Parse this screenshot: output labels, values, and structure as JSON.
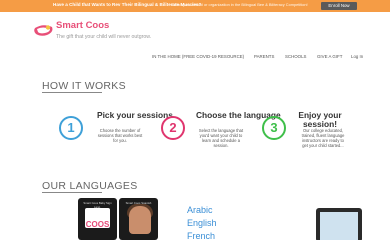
{
  "promo": {
    "title": "Have a Child that Wants to Rev Their Bilingual & Biliterate Muscles?",
    "description": "Enroll your school or organization in the Bilingual Bee & Biliteracy Competition!",
    "button_label": "Enroll Now"
  },
  "header": {
    "logo_text": "SMART COOS",
    "brand": "Smart Coos",
    "tagline": "The gift that your child will never outgrow."
  },
  "nav": {
    "home": "IN THE HOME (FREE COVID-19 RESOURCE)",
    "parents": "PARENTS",
    "schools": "SCHOOLS",
    "gift": "GIVE A GIFT",
    "login": "Log In"
  },
  "how_it_works": {
    "title": "HOW IT WORKS",
    "steps": [
      {
        "number": "1",
        "title": "Pick your sessions",
        "description": "Choose the number of sessions that works best for you."
      },
      {
        "number": "2",
        "title": "Choose the language",
        "description": "Select the language that you'd want your child to learn and schedule a session."
      },
      {
        "number": "3",
        "title_line1": "Enjoy your",
        "title_line2": "session!",
        "description": "Our college educated, trained, fluent language instructors are ready to get your child started..."
      }
    ]
  },
  "languages": {
    "title": "OUR LANGUAGES",
    "phone1_caption": "Smart Coos Baby Sign Lang.",
    "phone2_caption": "Smart Coos Spanish Cours.",
    "phone1_brand": "COOS",
    "items": [
      "Arabic",
      "English",
      "French"
    ]
  },
  "colors": {
    "banner": "#f59c45",
    "brand_pink": "#e84f78",
    "step1": "#3ea0d8",
    "step2": "#e0356e",
    "step3": "#3fbf4a",
    "language_blue": "#3b8fd6"
  }
}
